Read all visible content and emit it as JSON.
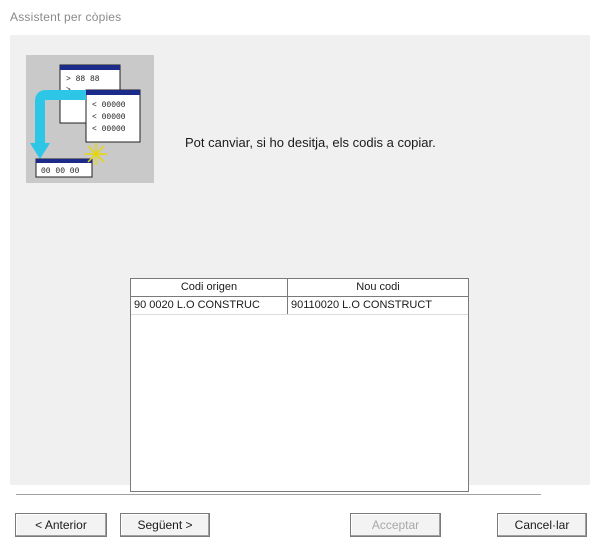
{
  "window": {
    "title": "Assistent per còpies"
  },
  "illustration": {
    "icon": "copy-wizard-icon",
    "back_rows": [
      "> 88 88",
      ">"
    ],
    "front_rows": [
      "< 00000",
      "< 00000",
      "< 00000"
    ],
    "target_row": "00 00 00"
  },
  "instruction": {
    "text": "Pot canviar, si ho desitja, els codis a copiar."
  },
  "grid": {
    "columns": [
      "Codi origen",
      "Nou codi"
    ],
    "rows": [
      [
        "90   0020 L.O CONSTRUC",
        "90110020 L.O CONSTRUCT"
      ]
    ]
  },
  "buttons": {
    "previous": "< Anterior",
    "next": "Següent >",
    "accept": "Acceptar",
    "cancel": "Cancel·lar"
  }
}
